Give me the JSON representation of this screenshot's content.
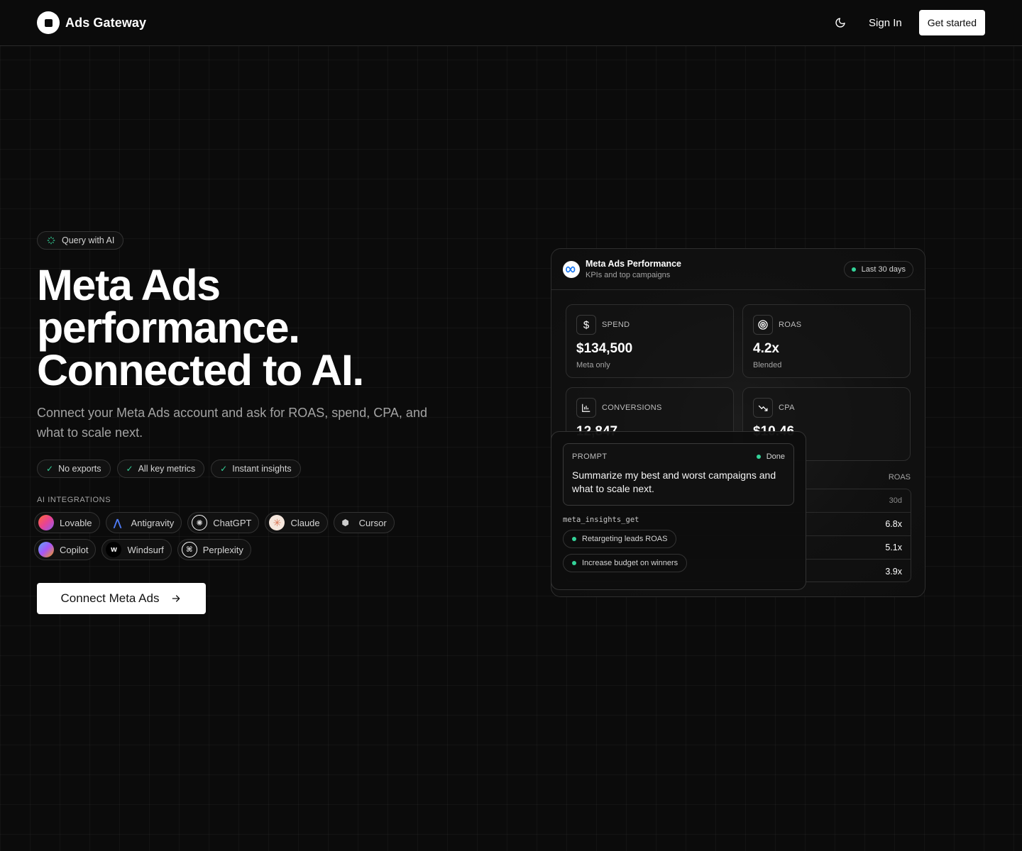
{
  "header": {
    "brand": "Ads Gateway",
    "signin": "Sign In",
    "get_started": "Get started"
  },
  "hero": {
    "badge": "Query with AI",
    "title_lines": [
      "Meta Ads",
      "performance.",
      "Connected to AI."
    ],
    "subtitle": "Connect your Meta Ads account and ask for ROAS, spend, CPA, and what to scale next.",
    "features": [
      "No exports",
      "All key metrics",
      "Instant insights"
    ],
    "integrations_label": "AI INTEGRATIONS",
    "integrations": [
      {
        "name": "Lovable",
        "icon": "lovable-icon",
        "color": "#f0548a"
      },
      {
        "name": "Antigravity",
        "icon": "antigravity-icon",
        "color": "#4f7cf7"
      },
      {
        "name": "ChatGPT",
        "icon": "chatgpt-icon",
        "color": "#ffffff"
      },
      {
        "name": "Claude",
        "icon": "claude-icon",
        "color": "#d97757"
      },
      {
        "name": "Cursor",
        "icon": "cursor-icon",
        "color": "#cccccc"
      },
      {
        "name": "Copilot",
        "icon": "copilot-icon",
        "color": "#5aa9f7"
      },
      {
        "name": "Windsurf",
        "icon": "windsurf-icon",
        "color": "#ffffff"
      },
      {
        "name": "Perplexity",
        "icon": "perplexity-icon",
        "color": "#ffffff"
      }
    ],
    "cta": "Connect Meta Ads"
  },
  "dashboard": {
    "title": "Meta Ads Performance",
    "subtitle": "KPIs and top campaigns",
    "range": "Last 30 days",
    "kpis": [
      {
        "label": "SPEND",
        "value": "$134,500",
        "note": "Meta only",
        "icon": "dollar-icon"
      },
      {
        "label": "ROAS",
        "value": "4.2x",
        "note": "Blended",
        "icon": "target-icon"
      },
      {
        "label": "CONVERSIONS",
        "value": "12,847",
        "note": "",
        "icon": "bar-chart-icon"
      },
      {
        "label": "CPA",
        "value": "$10.46",
        "note": "",
        "icon": "trend-down-icon"
      }
    ],
    "table": {
      "roas_label": "ROAS",
      "period": "30d",
      "rows": [
        "6.8x",
        "5.1x",
        "3.9x"
      ]
    }
  },
  "prompt": {
    "label": "PROMPT",
    "status": "Done",
    "text": "Summarize my best and worst campaigns and what to scale next.",
    "tool": "meta_insights_get",
    "results": [
      "Retargeting leads ROAS",
      "Increase budget on winners"
    ]
  },
  "colors": {
    "background": "#0b0b0b",
    "accent_green": "#34d399",
    "border": "#2e2e2e"
  }
}
